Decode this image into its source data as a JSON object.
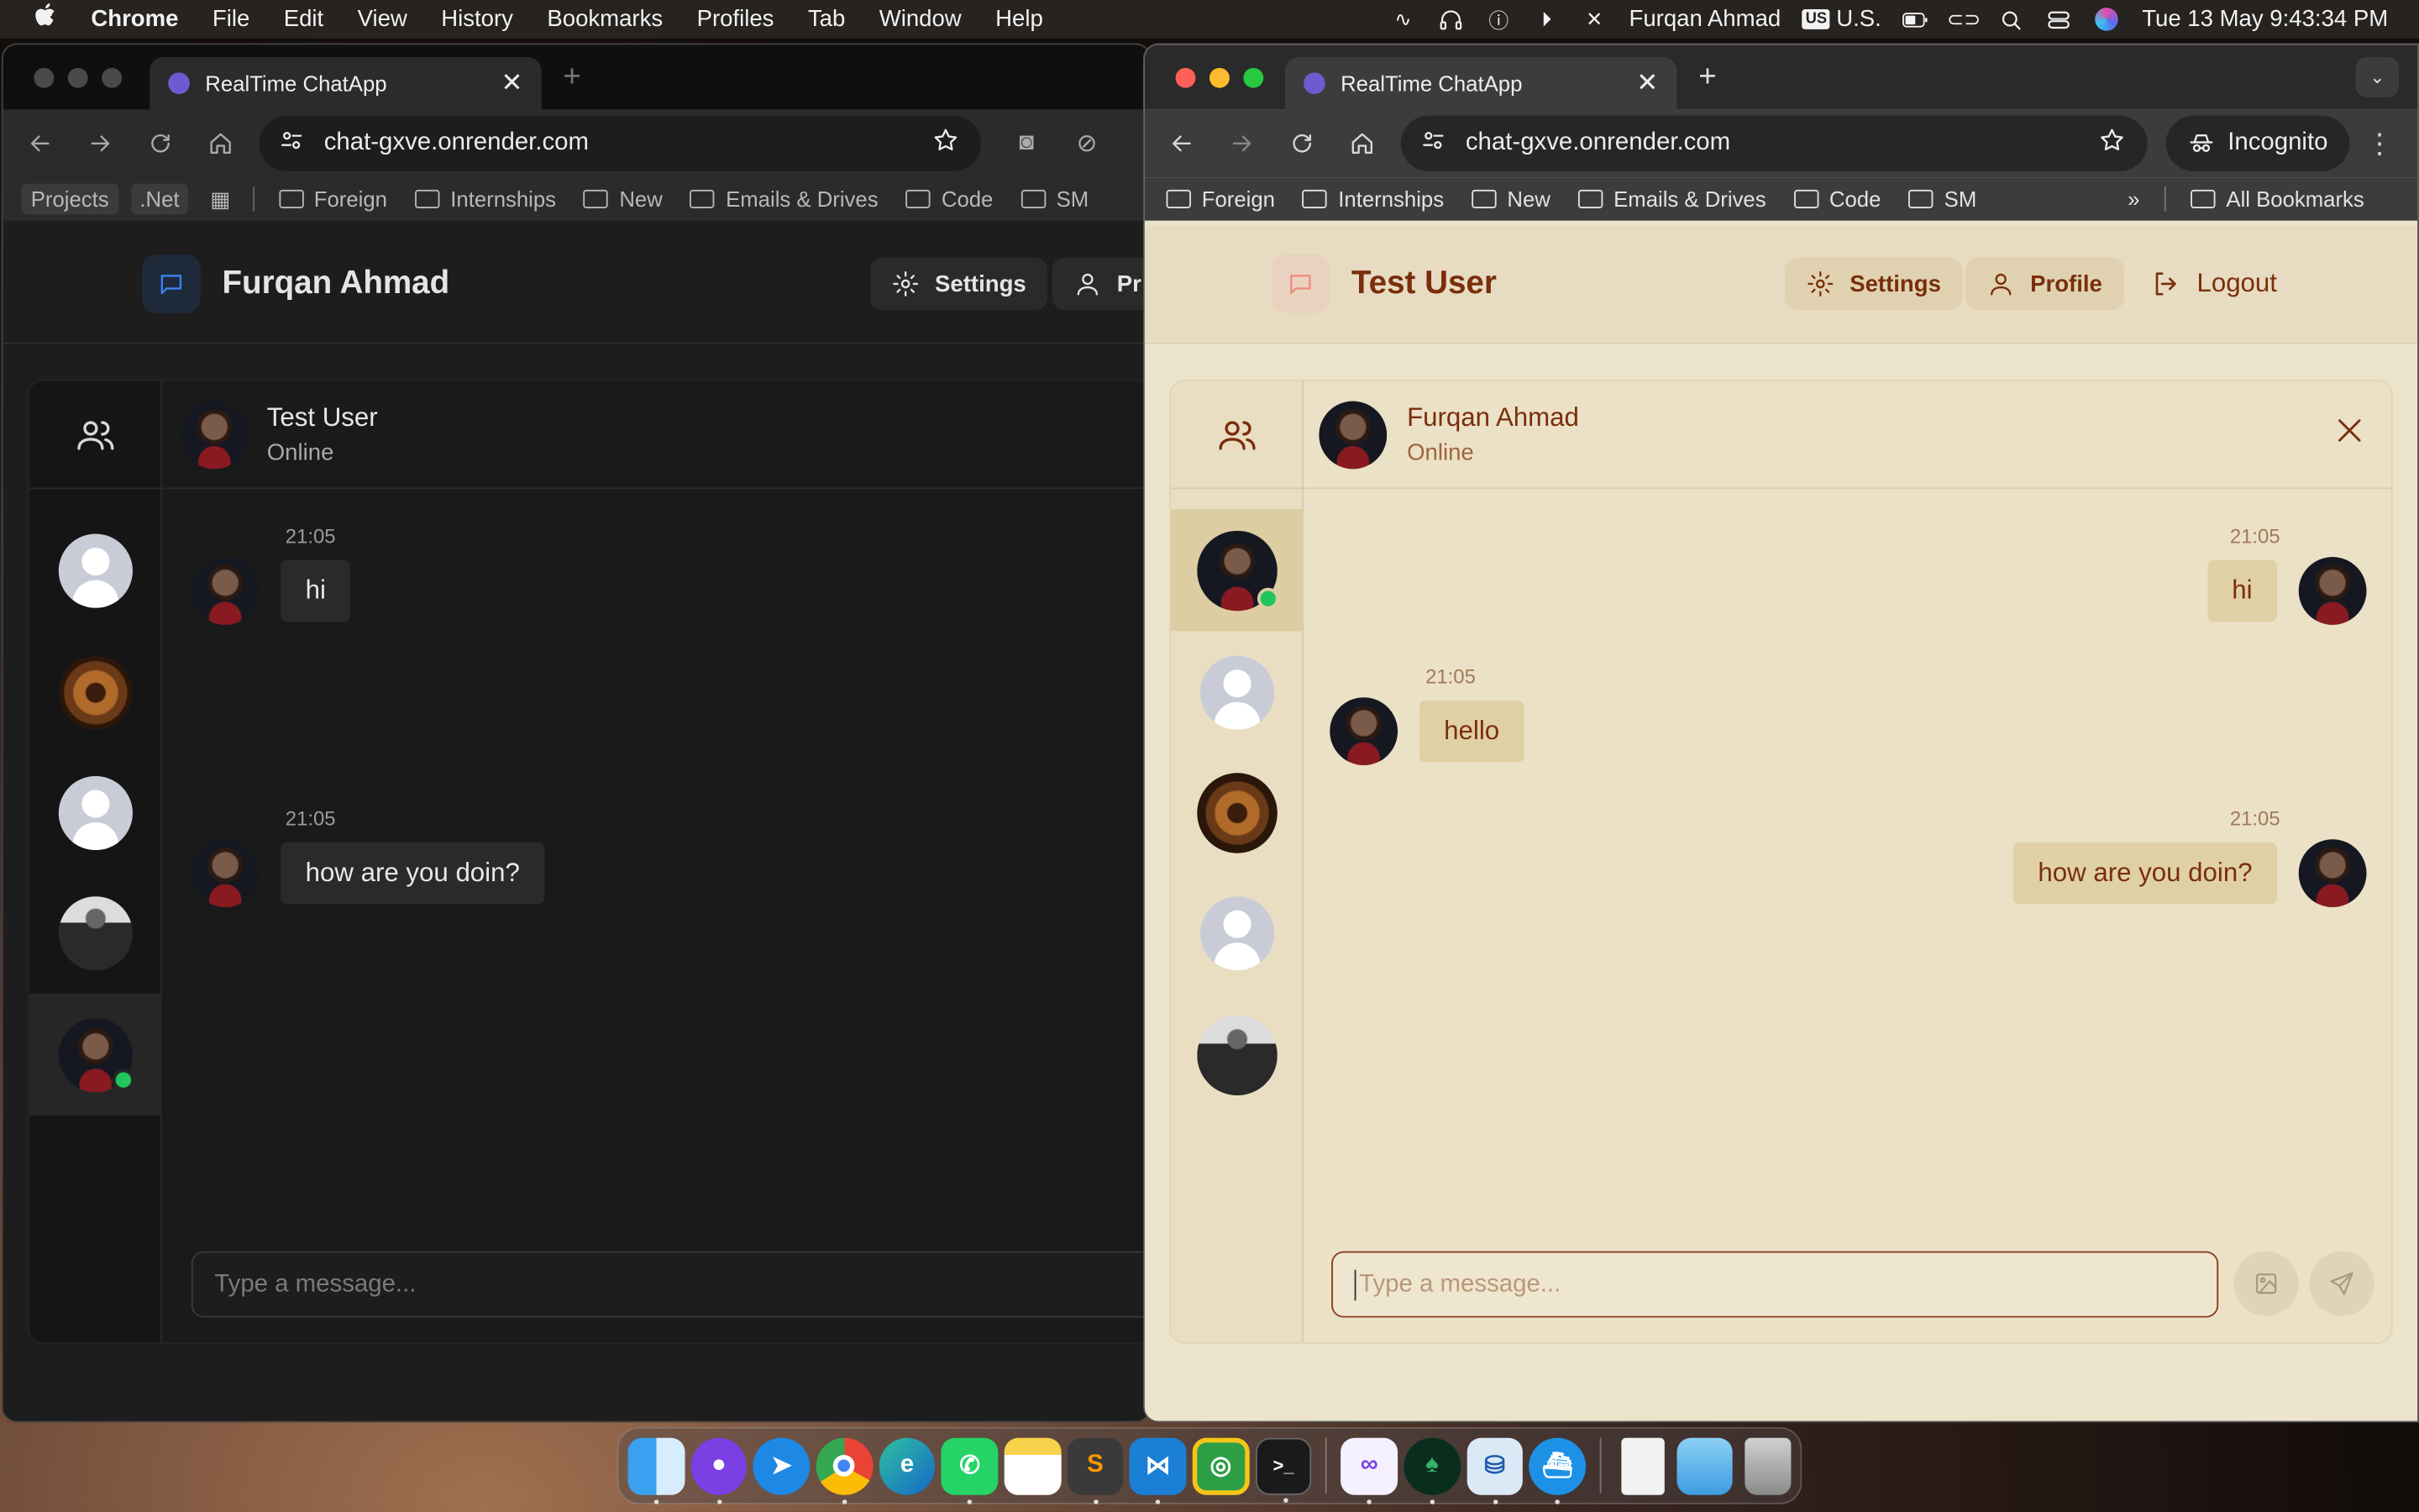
{
  "menubar": {
    "apple": "",
    "app": "Chrome",
    "items": [
      "File",
      "Edit",
      "View",
      "History",
      "Bookmarks",
      "Profiles",
      "Tab",
      "Window",
      "Help"
    ],
    "user": "Furqan Ahmad",
    "input_source": "U.S.",
    "input_badge": "US",
    "clock": "Tue 13 May  9:43:34 PM"
  },
  "left_window": {
    "tab_title": "RealTime ChatApp",
    "url": "chat-gxve.onrender.com",
    "bookmarks": [
      "Projects",
      ".Net",
      "Foreign",
      "Internships",
      "New",
      "Emails & Drives",
      "Code",
      "SM"
    ],
    "app_title": "Furqan Ahmad",
    "settings_label": "Settings",
    "profile_label": "Pr",
    "chat_name": "Test User",
    "chat_status": "Online",
    "messages": [
      {
        "time": "21:05",
        "text": "hi"
      },
      {
        "time": "21:05",
        "text": "how are you doin?"
      }
    ],
    "input_placeholder": "Type a message..."
  },
  "right_window": {
    "tab_title": "RealTime ChatApp",
    "url": "chat-gxve.onrender.com",
    "incognito_label": "Incognito",
    "bookmarks": [
      "Foreign",
      "Internships",
      "New",
      "Emails & Drives",
      "Code",
      "SM"
    ],
    "all_bookmarks": "All Bookmarks",
    "app_title": "Test User",
    "settings_label": "Settings",
    "profile_label": "Profile",
    "logout_label": "Logout",
    "chat_name": "Furqan Ahmad",
    "chat_status": "Online",
    "messages": [
      {
        "time": "21:05",
        "text": "hi"
      },
      {
        "time": "21:05",
        "text": "hello"
      },
      {
        "time": "21:05",
        "text": "how are you doin?"
      }
    ],
    "input_placeholder": "Type a message..."
  },
  "dock": [
    "Finder",
    "GitHub Desktop",
    "Safari",
    "Chrome",
    "Edge",
    "WhatsApp",
    "Notes",
    "Sublime Text",
    "VS Code",
    "Classroom",
    "Terminal",
    "Visual Studio",
    "MongoDB Compass",
    "Azure Data Studio",
    "Docker",
    "Preview",
    "Files",
    "Trash"
  ],
  "colors": {
    "dark_bg": "#1d1d1d",
    "light_bg": "#ece3cb",
    "accent_brown": "#7a2e0c",
    "online": "#21c55d"
  }
}
